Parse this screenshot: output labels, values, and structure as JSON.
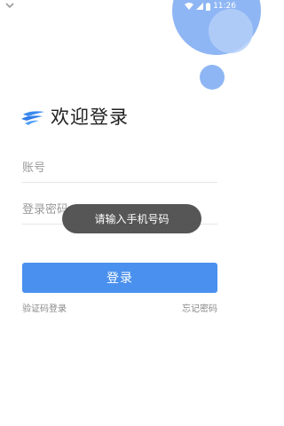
{
  "status_bar": {
    "time": "11:26",
    "icons": [
      "notification-icon",
      "wifi-icon",
      "signal-icon",
      "battery-icon"
    ]
  },
  "header": {
    "logo_icon": "app-logo-icon",
    "title": "欢迎登录"
  },
  "form": {
    "account_placeholder": "账号",
    "password_placeholder": "登录密码",
    "login_label": "登录",
    "sms_login_label": "验证码登录",
    "forgot_password_label": "忘记密码"
  },
  "toast": {
    "message": "请输入手机号码"
  },
  "colors": {
    "accent": "#4a90ee",
    "circle_primary": "#8fb6f4",
    "circle_secondary": "#b4cff8",
    "toast_bg": "#4d4d4d"
  }
}
